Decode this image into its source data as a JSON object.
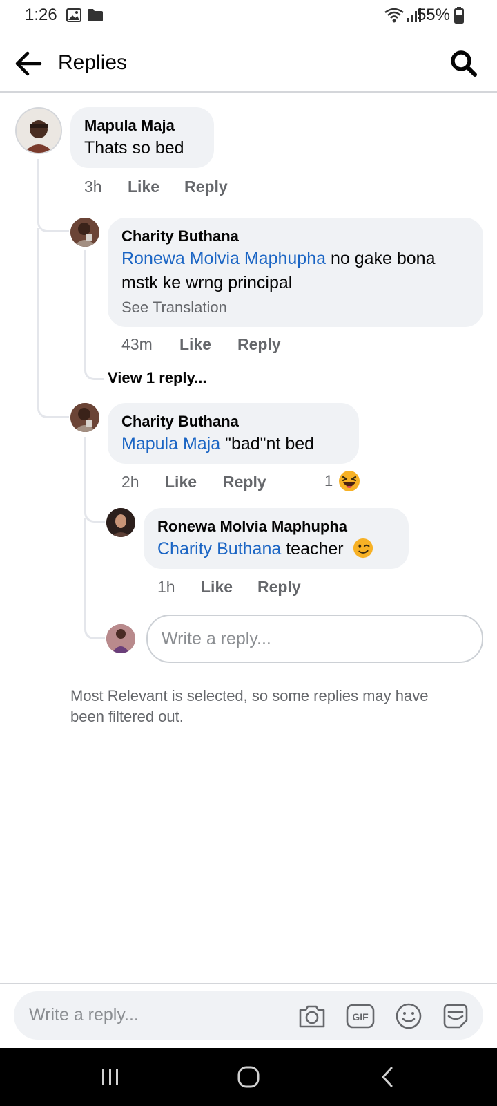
{
  "status": {
    "time": "1:26",
    "battery": "55%"
  },
  "header": {
    "title": "Replies"
  },
  "comments": [
    {
      "author": "Mapula Maja",
      "text": "Thats so bed",
      "time": "3h",
      "like": "Like",
      "reply": "Reply"
    },
    {
      "author": "Charity Buthana",
      "mention": "Ronewa Molvia Maphupha",
      "text": " no gake bona mstk ke wrng principal",
      "translation": "See Translation",
      "time": "43m",
      "like": "Like",
      "reply": "Reply",
      "view_replies": "View 1 reply..."
    },
    {
      "author": "Charity Buthana",
      "mention": "Mapula Maja",
      "text": " \"bad\"nt bed",
      "time": "2h",
      "like": "Like",
      "reply": "Reply",
      "reaction_count": "1"
    },
    {
      "author": "Ronewa Molvia Maphupha",
      "mention": "Charity Buthana",
      "text": " teacher",
      "time": "1h",
      "like": "Like",
      "reply": "Reply"
    }
  ],
  "reply_input": {
    "placeholder": "Write a reply..."
  },
  "filter_note": "Most Relevant is selected, so some replies may have been filtered out.",
  "composer": {
    "placeholder": "Write a reply...",
    "gif_label": "GIF"
  },
  "icons": [
    "back-arrow-icon",
    "search-icon",
    "camera-icon",
    "gif-icon",
    "emoji-icon",
    "sticker-icon",
    "laughing-emoji-icon",
    "winking-emoji-icon"
  ],
  "colors": {
    "mention": "#1b65c4",
    "bubble": "#f0f2f5",
    "secondary_text": "#65676b",
    "reaction_yellow": "#f7b125"
  }
}
